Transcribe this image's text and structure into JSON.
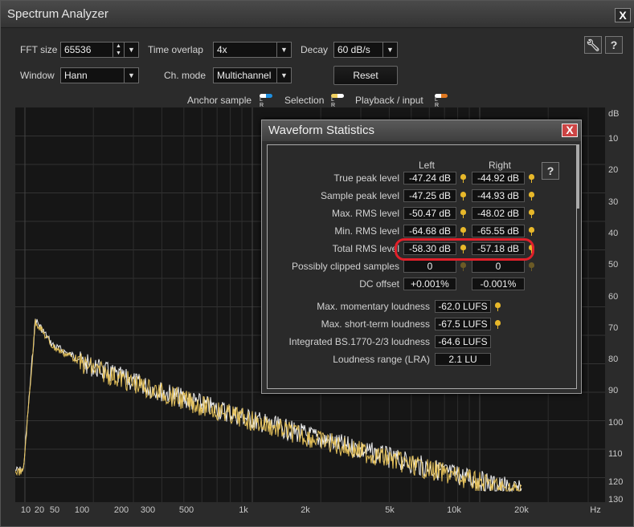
{
  "window": {
    "title": "Spectrum Analyzer",
    "close_label": "X"
  },
  "controls": {
    "fft_size_label": "FFT size",
    "fft_size_value": "65536",
    "time_overlap_label": "Time overlap",
    "time_overlap_value": "4x",
    "decay_label": "Decay",
    "decay_value": "60 dB/s",
    "window_label": "Window",
    "window_value": "Hann",
    "ch_mode_label": "Ch. mode",
    "ch_mode_value": "Multichannel",
    "reset_label": "Reset",
    "wrench_icon": "wrench-icon",
    "help_label": "?"
  },
  "legend": {
    "anchor_label": "Anchor sample",
    "selection_label": "Selection",
    "playback_label": "Playback / input",
    "lr": "L R",
    "colors": {
      "anchor_l": "#ffffff",
      "anchor_r": "#1e8fe0",
      "selection_l": "#f0d060",
      "selection_r": "#ffffff",
      "playback_l": "#ffffff",
      "playback_r": "#e07820"
    }
  },
  "axis": {
    "y_unit": "dB",
    "y_ticks": [
      "10",
      "20",
      "30",
      "40",
      "50",
      "60",
      "70",
      "80",
      "90",
      "100",
      "110",
      "120",
      "130"
    ],
    "x_ticks": [
      "10",
      "20",
      "50",
      "100",
      "200",
      "300",
      "500",
      "1k",
      "2k",
      "5k",
      "10k",
      "20k",
      "Hz"
    ]
  },
  "spectrum": {
    "series": [
      {
        "color": "#f0f0f0"
      },
      {
        "color": "#e6c25a"
      }
    ]
  },
  "dialog": {
    "title": "Waveform Statistics",
    "close_label": "X",
    "help_label": "?",
    "col_left": "Left",
    "col_right": "Right",
    "rows": [
      {
        "label": "True peak level",
        "left": "-47.24 dB",
        "right": "-44.92 dB"
      },
      {
        "label": "Sample peak level",
        "left": "-47.25 dB",
        "right": "-44.93 dB"
      },
      {
        "label": "Max. RMS level",
        "left": "-50.47 dB",
        "right": "-48.02 dB"
      },
      {
        "label": "Min. RMS level",
        "left": "-64.68 dB",
        "right": "-65.55 dB"
      },
      {
        "label": "Total RMS level",
        "left": "-58.30 dB",
        "right": "-57.18 dB"
      },
      {
        "label": "Possibly clipped samples",
        "left": "0",
        "right": "0"
      },
      {
        "label": "DC offset",
        "left": "+0.001%",
        "right": "-0.001%"
      }
    ],
    "loudness": [
      {
        "label": "Max. momentary loudness",
        "value": "-62.0 LUFS"
      },
      {
        "label": "Max. short-term loudness",
        "value": "-67.5 LUFS"
      },
      {
        "label": "Integrated BS.1770-2/3 loudness",
        "value": "-64.6 LUFS"
      },
      {
        "label": "Loudness range (LRA)",
        "value": "2.1 LU"
      }
    ]
  }
}
